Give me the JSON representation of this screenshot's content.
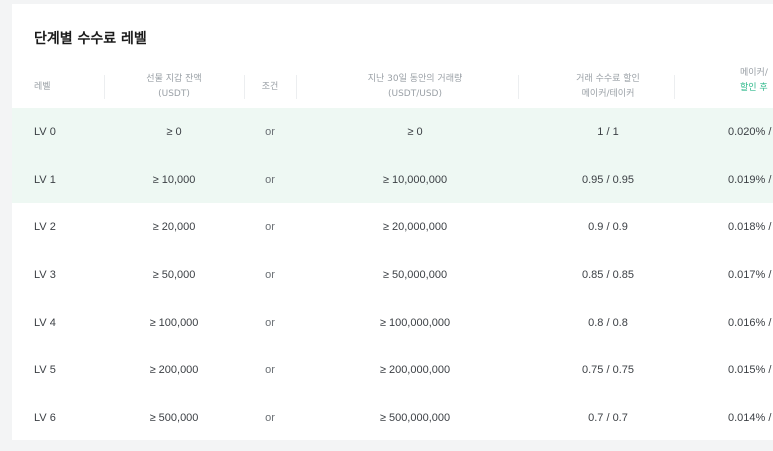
{
  "title": "단계별 수수료 레벨",
  "headers": {
    "level": "레벨",
    "balance_line1": "선물 지갑 잔액",
    "balance_line2": "(USDT)",
    "condition": "조건",
    "volume_line1": "지난 30일 동안의 거래량",
    "volume_line2": "(USDT/USD)",
    "discount_line1": "거래 수수료 할인",
    "discount_line2": "메이커/테이커",
    "fee_line1": "메이커/",
    "fee_line2": "할인 후"
  },
  "rows": [
    {
      "level": "LV 0",
      "balance": "≥ 0",
      "condition": "or",
      "volume": "≥ 0",
      "discount": "1 / 1",
      "fee": "0.020% /",
      "highlight": true
    },
    {
      "level": "LV 1",
      "balance": "≥ 10,000",
      "condition": "or",
      "volume": "≥ 10,000,000",
      "discount": "0.95 / 0.95",
      "fee": "0.019% /",
      "highlight": true
    },
    {
      "level": "LV 2",
      "balance": "≥ 20,000",
      "condition": "or",
      "volume": "≥ 20,000,000",
      "discount": "0.9 / 0.9",
      "fee": "0.018% /",
      "highlight": false
    },
    {
      "level": "LV 3",
      "balance": "≥ 50,000",
      "condition": "or",
      "volume": "≥ 50,000,000",
      "discount": "0.85 / 0.85",
      "fee": "0.017% /",
      "highlight": false
    },
    {
      "level": "LV 4",
      "balance": "≥ 100,000",
      "condition": "or",
      "volume": "≥ 100,000,000",
      "discount": "0.8 / 0.8",
      "fee": "0.016% /",
      "highlight": false
    },
    {
      "level": "LV 5",
      "balance": "≥ 200,000",
      "condition": "or",
      "volume": "≥ 200,000,000",
      "discount": "0.75 / 0.75",
      "fee": "0.015% /",
      "highlight": false
    },
    {
      "level": "LV 6",
      "balance": "≥ 500,000",
      "condition": "or",
      "volume": "≥ 500,000,000",
      "discount": "0.7 / 0.7",
      "fee": "0.014% /",
      "highlight": false
    }
  ],
  "colors": {
    "highlight_row": "#eef8f3",
    "accent_green": "#2fb98b",
    "header_text": "#9aa0a6",
    "body_text": "#3c4045"
  }
}
